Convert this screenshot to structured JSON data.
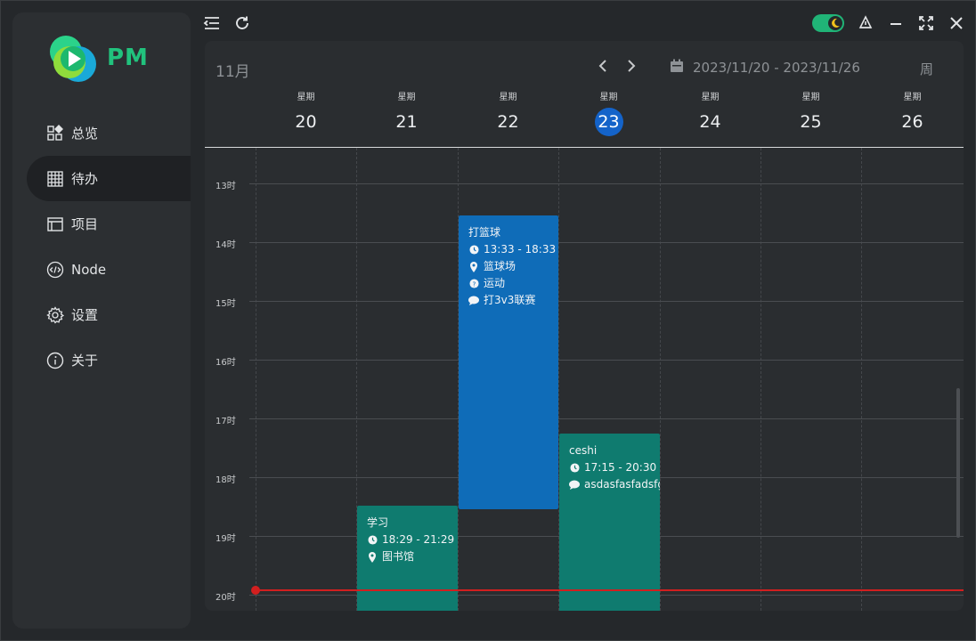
{
  "app": {
    "logo_text": "PM"
  },
  "sidebar": {
    "items": [
      {
        "label": "总览",
        "icon": "dashboard-icon"
      },
      {
        "label": "待办",
        "icon": "calendar-grid-icon",
        "active": true
      },
      {
        "label": "项目",
        "icon": "window-icon"
      },
      {
        "label": "Node",
        "icon": "code-icon"
      },
      {
        "label": "设置",
        "icon": "gear-icon"
      },
      {
        "label": "关于",
        "icon": "info-icon"
      }
    ]
  },
  "toolbar": {
    "left_icons": [
      "menu-collapse-icon",
      "refresh-icon"
    ],
    "right_icons": [
      "theme-toggle",
      "pin-icon",
      "minimize-icon",
      "maximize-icon",
      "close-icon"
    ]
  },
  "calendar": {
    "month": "11月",
    "date_range": "2023/11/20 - 2023/11/26",
    "view": "周",
    "days": [
      {
        "weekday": "星期",
        "date": "20"
      },
      {
        "weekday": "星期",
        "date": "21"
      },
      {
        "weekday": "星期",
        "date": "22"
      },
      {
        "weekday": "星期",
        "date": "23",
        "today": true
      },
      {
        "weekday": "星期",
        "date": "24"
      },
      {
        "weekday": "星期",
        "date": "25"
      },
      {
        "weekday": "星期",
        "date": "26"
      }
    ],
    "hours": [
      "13时",
      "14时",
      "15时",
      "16时",
      "17时",
      "18时",
      "19时",
      "20时"
    ],
    "events": [
      {
        "title": "打篮球",
        "time": "13:33 - 18:33",
        "location": "篮球场",
        "category": "运动",
        "note": "打3v3联赛",
        "day_index": 2,
        "color": "#0f6cb8"
      },
      {
        "title": "ceshi",
        "time": "17:15 - 20:30",
        "note": "asdasfasfadsfgas",
        "day_index": 3,
        "color": "#0f7b6f"
      },
      {
        "title": "学习",
        "time": "18:29 - 21:29",
        "location": "图书馆",
        "day_index": 1,
        "color": "#0f7b6f"
      }
    ],
    "now_color": "#d21f1f",
    "today_color": "#1463c9"
  },
  "colors": {
    "brand": "#21c27d",
    "toggle": "#20b477"
  }
}
